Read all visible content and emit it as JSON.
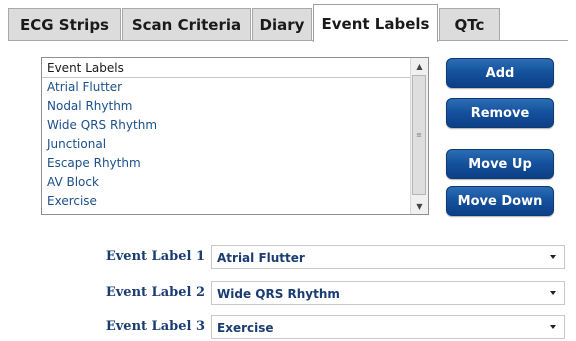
{
  "tabs": [
    {
      "label": "ECG Strips"
    },
    {
      "label": "Scan Criteria"
    },
    {
      "label": "Diary"
    },
    {
      "label": "Event Labels"
    },
    {
      "label": "QTc"
    }
  ],
  "active_tab": "Event Labels",
  "list": {
    "header": "Event Labels",
    "items": [
      "Atrial Flutter",
      "Nodal Rhythm",
      "Wide QRS Rhythm",
      "Junctional",
      "Escape Rhythm",
      "AV Block",
      "Exercise"
    ]
  },
  "buttons": {
    "add": "Add",
    "remove": "Remove",
    "move_up": "Move Up",
    "move_down": "Move Down"
  },
  "event_labels": [
    {
      "label": "Event Label 1",
      "value": "Atrial Flutter"
    },
    {
      "label": "Event Label 2",
      "value": "Wide QRS Rhythm"
    },
    {
      "label": "Event Label 3",
      "value": "Exercise"
    }
  ],
  "colors": {
    "button_blue": "#14509c",
    "label_navy": "#1b3c73",
    "list_text": "#1b4f8a"
  }
}
